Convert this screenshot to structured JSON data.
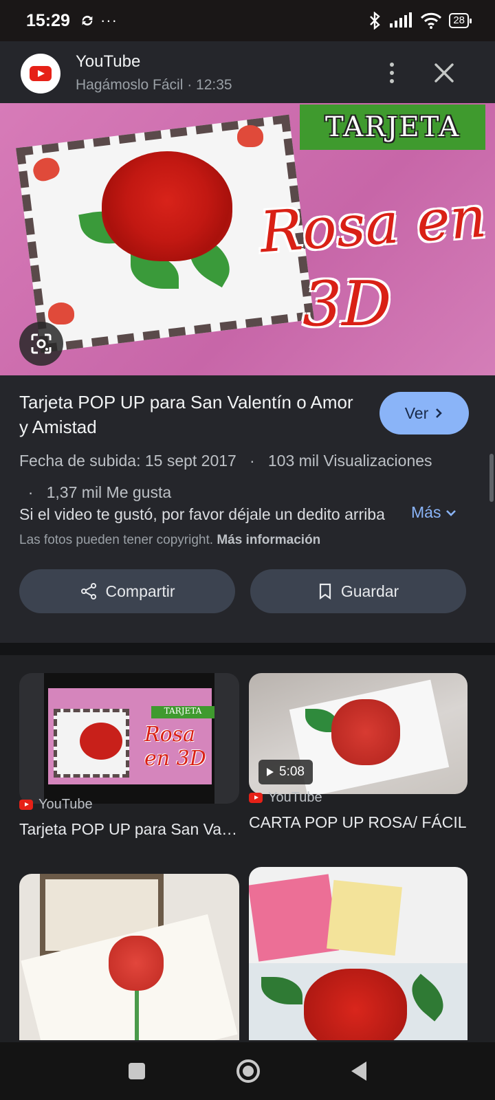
{
  "status_bar": {
    "time": "15:29",
    "dots": "···",
    "battery": "28",
    "icons": [
      "sync-icon",
      "bluetooth-icon",
      "signal-icon",
      "wifi-icon",
      "battery-icon"
    ]
  },
  "source": {
    "name": "YouTube",
    "meta": "Hagámoslo Fácil · 12:35"
  },
  "hero": {
    "tag": "TARJETA",
    "title_line1": "Rosa en",
    "title_line2": "3D"
  },
  "video": {
    "title": "Tarjeta POP UP para San Valentín o Amor y Amistad",
    "ver_label": "Ver",
    "meta_upload": "Fecha de subida: 15 sept 2017",
    "meta_views": "103 mil Visualizaciones",
    "meta_likes": "1,37 mil Me gusta",
    "description": "Si el video te gustó, por favor déjale un dedito arriba",
    "more_label": "Más",
    "copyright_text": "Las fotos pueden tener copyright.",
    "copyright_link": "Más información"
  },
  "actions": {
    "share_label": "Compartir",
    "save_label": "Guardar"
  },
  "related": [
    {
      "source": "YouTube",
      "title": "Tarjeta POP UP para San Valentín o Amor y Amistad",
      "thumb_tag": "TARJETA",
      "thumb_title": "Rosa en 3D"
    },
    {
      "source": "YouTube",
      "title": "CARTA POP UP ROSA/ FÁCIL",
      "duration": "5:08"
    },
    {
      "title": ""
    },
    {
      "title": ""
    }
  ],
  "colors": {
    "accent": "#8ab4f8",
    "youtube_red": "#e62117",
    "sheet_bg": "#25262b",
    "pill_bg": "#3c4350"
  }
}
